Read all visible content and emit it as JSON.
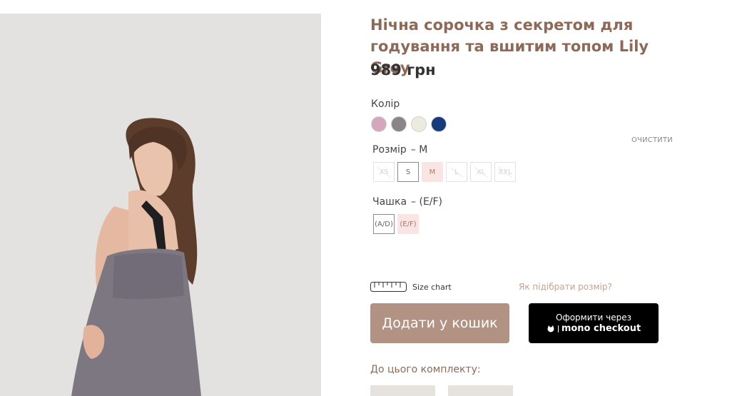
{
  "product": {
    "title": "Нічна сорочка з секретом для годування та вшитим топом Lily Grey",
    "price": "989 грн"
  },
  "color": {
    "label": "Колір",
    "swatches": [
      {
        "name": "pink",
        "hex": "#d5a7bd"
      },
      {
        "name": "grey",
        "hex": "#8a8586"
      },
      {
        "name": "ivory",
        "hex": "#ecebdf"
      },
      {
        "name": "navy",
        "hex": "#153b7d"
      }
    ],
    "clear_label": "ОЧИСТИТИ"
  },
  "size": {
    "label": "Розмір",
    "selected_text": "– M",
    "options": [
      {
        "label": "XS",
        "state": "unavailable"
      },
      {
        "label": "S",
        "state": "available"
      },
      {
        "label": "M",
        "state": "selected"
      },
      {
        "label": "L",
        "state": "unavailable"
      },
      {
        "label": "XL",
        "state": "unavailable"
      },
      {
        "label": "XXL",
        "state": "unavailable"
      }
    ]
  },
  "cup": {
    "label": "Чашка",
    "selected_text": "– (E/F)",
    "options": [
      {
        "label": "(A/D)",
        "state": "available"
      },
      {
        "label": "(E/F)",
        "state": "selected"
      }
    ]
  },
  "size_chart": {
    "label": "Size chart",
    "icon": "ruler-icon",
    "how_to_label": "Як підібрати розмір?"
  },
  "actions": {
    "add_to_cart": "Додати у кошик",
    "mono_line1": "Оформити через",
    "mono_line2": "mono checkout"
  },
  "set": {
    "label": "До цього комплекту:"
  },
  "colors": {
    "accent": "#8d6a58",
    "cart_button": "#b19283",
    "selected_option": "#fbe4e4"
  }
}
